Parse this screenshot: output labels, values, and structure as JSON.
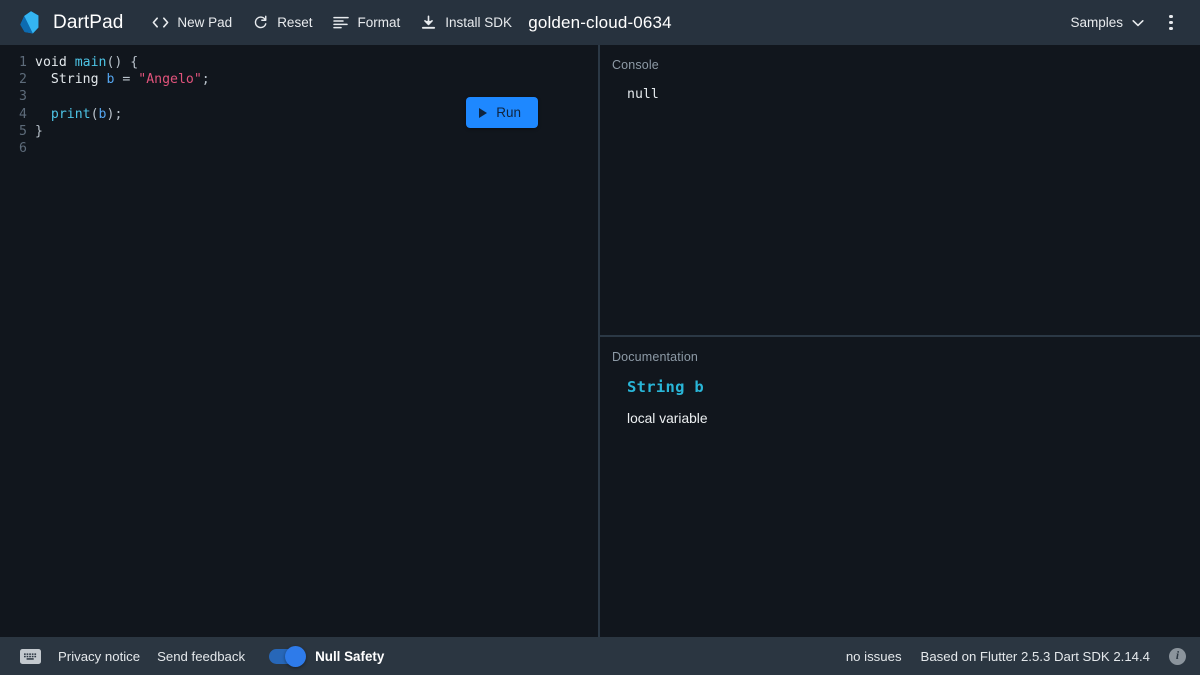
{
  "header": {
    "brand": "DartPad",
    "logo_icon": "dart-logo-icon",
    "toolbar": [
      {
        "label": "New Pad",
        "icon": "code-brackets-icon"
      },
      {
        "label": "Reset",
        "icon": "refresh-icon"
      },
      {
        "label": "Format",
        "icon": "format-align-left-icon"
      },
      {
        "label": "Install SDK",
        "icon": "download-icon"
      }
    ],
    "document_title": "golden-cloud-0634",
    "samples_label": "Samples",
    "samples_chevron_icon": "chevron-down-icon",
    "more_icon": "more-vertical-icon"
  },
  "editor": {
    "run_label": "Run",
    "run_icon": "play-triangle-icon",
    "line_numbers": [
      "1",
      "2",
      "3",
      "4",
      "5",
      "6"
    ],
    "lines": [
      {
        "num": "1",
        "tokens": [
          {
            "t": "void",
            "c": "kw"
          },
          {
            "t": " ",
            "c": "punct"
          },
          {
            "t": "main",
            "c": "fn"
          },
          {
            "t": "() {",
            "c": "punct"
          }
        ]
      },
      {
        "num": "2",
        "tokens": [
          {
            "t": "  ",
            "c": "punct"
          },
          {
            "t": "String",
            "c": "type"
          },
          {
            "t": " ",
            "c": "punct"
          },
          {
            "t": "b",
            "c": "var"
          },
          {
            "t": " = ",
            "c": "punct"
          },
          {
            "t": "\"Angelo\"",
            "c": "str"
          },
          {
            "t": ";",
            "c": "punct"
          }
        ]
      },
      {
        "num": "3",
        "tokens": []
      },
      {
        "num": "4",
        "tokens": [
          {
            "t": "  ",
            "c": "punct"
          },
          {
            "t": "print",
            "c": "fn"
          },
          {
            "t": "(",
            "c": "punct"
          },
          {
            "t": "b",
            "c": "var"
          },
          {
            "t": ");",
            "c": "punct"
          }
        ]
      },
      {
        "num": "5",
        "tokens": [
          {
            "t": "}",
            "c": "punct"
          }
        ]
      },
      {
        "num": "6",
        "tokens": []
      }
    ]
  },
  "console": {
    "label": "Console",
    "output": "null"
  },
  "documentation": {
    "label": "Documentation",
    "signature": "String b",
    "description": "local variable"
  },
  "footer": {
    "keyboard_icon": "keyboard-icon",
    "privacy_label": "Privacy notice",
    "feedback_label": "Send feedback",
    "null_safety_label": "Null Safety",
    "null_safety_enabled": true,
    "issues_label": "no issues",
    "version_label": "Based on Flutter 2.5.3 Dart SDK 2.14.4",
    "info_icon": "info-icon",
    "info_glyph": "i"
  },
  "colors": {
    "header_bg": "#27323e",
    "footer_bg": "#2b3641",
    "editor_bg": "#11161d",
    "accent_blue": "#1e88ff",
    "doc_cyan": "#29b6d8",
    "string_pink": "#e0537b"
  }
}
